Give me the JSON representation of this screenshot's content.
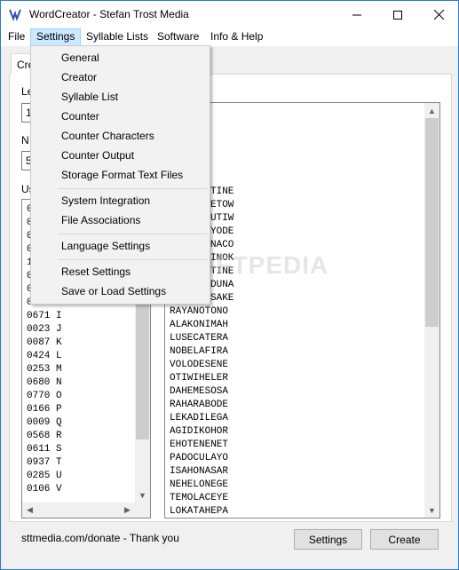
{
  "window": {
    "title": "WordCreator - Stefan Trost Media"
  },
  "menubar": {
    "items": [
      "File",
      "Settings",
      "Syllable Lists",
      "Software",
      "Info & Help"
    ]
  },
  "tab": {
    "label": "Cre"
  },
  "left_panel": {
    "length_label": "Le",
    "length_value": "1",
    "number_label": "N",
    "number_value": "5",
    "used_label": "Us",
    "list_items": [
      "0",
      "0",
      "0",
      "0",
      "1",
      "0",
      "0",
      "0611 H",
      "0671 I",
      "0023 J",
      "0087 K",
      "0424 L",
      "0253 M",
      "0680 N",
      "0770 O",
      "0166 P",
      "0009 Q",
      "0568 R",
      "0611 S",
      "0937 T",
      "0285 U",
      "0106 V"
    ]
  },
  "results": {
    "items": [
      "TINE",
      "ETOW",
      "UTIW",
      "YODE",
      "NACO",
      "INOK",
      "TINE",
      "DUNA",
      "SAKE",
      "RAYANOTONO",
      "ALAKONIMAH",
      "LUSECATERA",
      "NOBELAFIRA",
      "VOLODESENE",
      "OTIWIHELER",
      "DAHEMESOSA",
      "RAHARABODE",
      "LEKADILEGA",
      "AGIDIKOHOR",
      "EHOTENENET",
      "PADOCULAYO",
      "ISAHONASAR",
      "NEHELONEGE",
      "TEMOLACEYE",
      "LOKATAHEPA"
    ]
  },
  "settings_menu": {
    "items": [
      "General",
      "Creator",
      "Syllable List",
      "Counter",
      "Counter Characters",
      "Counter Output",
      "Storage Format Text Files",
      "System Integration",
      "File Associations",
      "Language Settings",
      "Reset Settings",
      "Save or Load Settings"
    ]
  },
  "footer": {
    "donate_text": "sttmedia.com/donate - Thank you",
    "settings_button": "Settings",
    "create_button": "Create"
  },
  "watermark": "SOFTPEDIA"
}
